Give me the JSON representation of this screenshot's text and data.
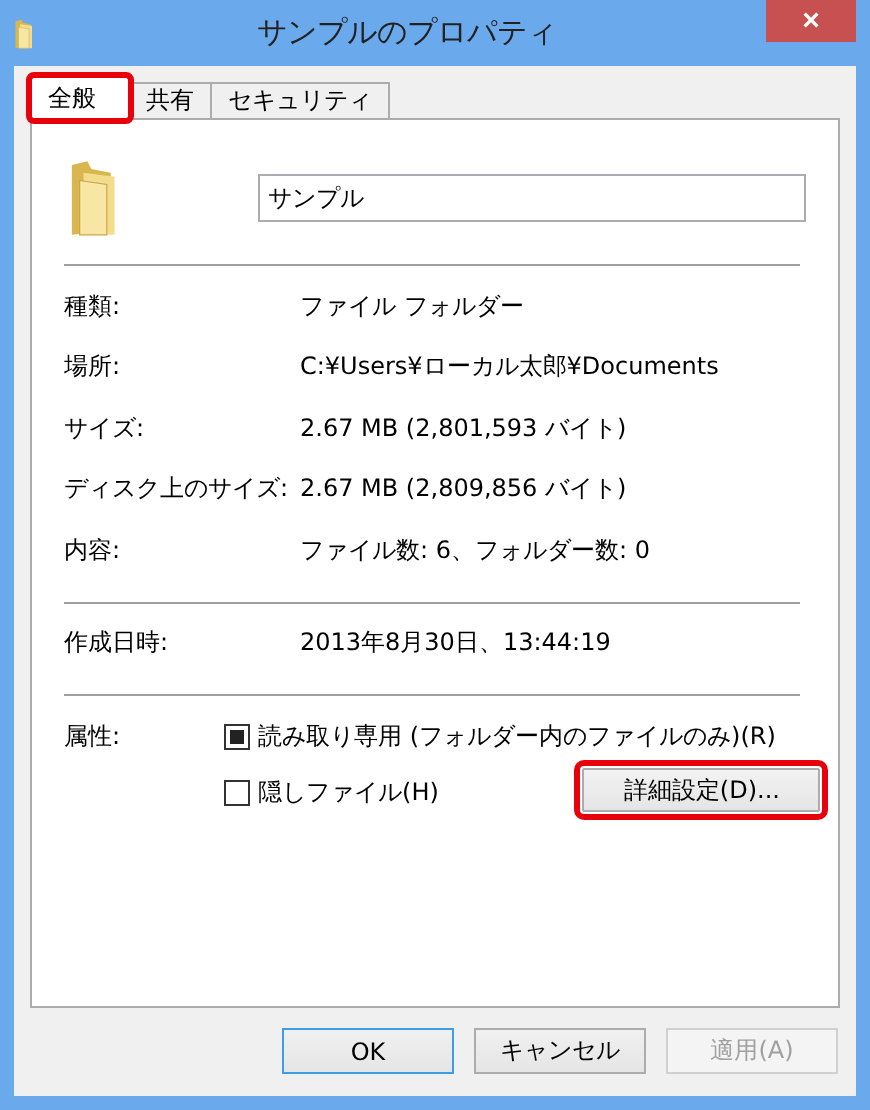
{
  "window": {
    "title": "サンプルのプロパティ",
    "close": "×"
  },
  "tabs": [
    {
      "label": "全般",
      "selected": true,
      "highlighted": true
    },
    {
      "label": "共有",
      "selected": false,
      "highlighted": false
    },
    {
      "label": "セキュリティ",
      "selected": false,
      "highlighted": false
    }
  ],
  "name_field": {
    "value": "サンプル"
  },
  "info_groups": [
    [
      {
        "label": "種類:",
        "value": "ファイル フォルダー"
      },
      {
        "label": "場所:",
        "value": "C:¥Users¥ローカル太郎¥Documents"
      },
      {
        "label": "サイズ:",
        "value": "2.67 MB (2,801,593 バイト)"
      },
      {
        "label": "ディスク上のサイズ:",
        "value": "2.67 MB (2,809,856 バイト)"
      },
      {
        "label": "内容:",
        "value": "ファイル数: 6、フォルダー数: 0"
      }
    ],
    [
      {
        "label": "作成日時:",
        "value": "2013年8月30日、13:44:19"
      }
    ]
  ],
  "attributes": {
    "label": "属性:",
    "checkboxes": [
      {
        "label": "読み取り専用 (フォルダー内のファイルのみ)(R)",
        "checked": false,
        "indeterminate": true
      },
      {
        "label": "隠しファイル(H)",
        "checked": false,
        "indeterminate": false
      }
    ],
    "advanced_button": {
      "label": "詳細設定(D)...",
      "highlighted": true
    }
  },
  "buttons": [
    {
      "label": "OK",
      "default": true,
      "disabled": false
    },
    {
      "label": "キャンセル",
      "default": false,
      "disabled": false
    },
    {
      "label": "適用(A)",
      "default": false,
      "disabled": true
    }
  ]
}
